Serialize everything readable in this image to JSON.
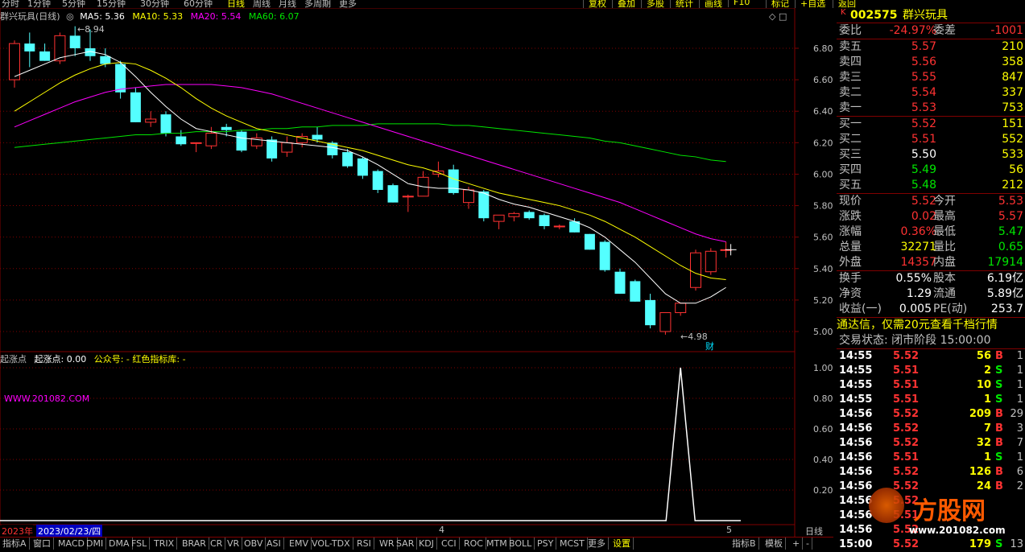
{
  "topbar": {
    "periods": [
      "分时",
      "1分钟",
      "5分钟",
      "15分钟",
      "30分钟",
      "60分钟",
      "日线",
      "周线",
      "月线",
      "多周期",
      "更多"
    ],
    "active_period": "日线",
    "right_buttons": [
      "复权",
      "叠加",
      "多股",
      "统计",
      "画线",
      "F10",
      "标记",
      "+自选",
      "返回"
    ]
  },
  "legend": {
    "title": "群兴玩具(日线)",
    "ma5": "MA5: 5.36",
    "ma10": "MA10: 5.33",
    "ma20": "MA20: 5.54",
    "ma60": "MA60: 6.07",
    "high_marker": "8.94",
    "low_marker": "4.98",
    "fin_marker": "财"
  },
  "colors": {
    "up": "#ff3232",
    "down": "#54ffff",
    "ma5": "#ffffff",
    "ma10": "#ffff00",
    "ma20": "#ff00ff",
    "ma60": "#00e600",
    "grid": "#800000"
  },
  "indicator": {
    "name": "起涨点",
    "value": "起涨点: 0.00",
    "public": "公众号: - 红色指标库: -",
    "watermark": "WWW.201082.COM",
    "y_ticks": [
      "1.00",
      "0.80",
      "0.60",
      "0.40",
      "0.20"
    ]
  },
  "chart_data": {
    "type": "candlestick",
    "y_ticks": [
      "6.80",
      "6.60",
      "6.40",
      "6.20",
      "6.00",
      "5.80",
      "5.60",
      "5.40",
      "5.20",
      "5.00"
    ],
    "ylim": [
      4.92,
      6.92
    ],
    "candles": [
      [
        6.6,
        6.85,
        6.55,
        6.83
      ],
      [
        6.83,
        6.9,
        6.68,
        6.78
      ],
      [
        6.78,
        6.83,
        6.72,
        6.72
      ],
      [
        6.72,
        6.9,
        6.7,
        6.88
      ],
      [
        6.88,
        6.94,
        6.75,
        6.8
      ],
      [
        6.8,
        6.92,
        6.72,
        6.75
      ],
      [
        6.75,
        6.8,
        6.68,
        6.7
      ],
      [
        6.7,
        6.72,
        6.48,
        6.52
      ],
      [
        6.52,
        6.55,
        6.33,
        6.33
      ],
      [
        6.33,
        6.4,
        6.3,
        6.35
      ],
      [
        6.38,
        6.4,
        6.24,
        6.26
      ],
      [
        6.24,
        6.28,
        6.18,
        6.19
      ],
      [
        6.2,
        6.2,
        6.14,
        6.2
      ],
      [
        6.18,
        6.3,
        6.16,
        6.26
      ],
      [
        6.3,
        6.32,
        6.24,
        6.28
      ],
      [
        6.27,
        6.28,
        6.14,
        6.15
      ],
      [
        6.18,
        6.26,
        6.16,
        6.23
      ],
      [
        6.22,
        6.24,
        6.08,
        6.1
      ],
      [
        6.14,
        6.24,
        6.11,
        6.2
      ],
      [
        6.2,
        6.26,
        6.17,
        6.24
      ],
      [
        6.25,
        6.3,
        6.2,
        6.22
      ],
      [
        6.2,
        6.21,
        6.1,
        6.12
      ],
      [
        6.14,
        6.16,
        6.04,
        6.05
      ],
      [
        6.1,
        6.11,
        5.97,
        5.99
      ],
      [
        6.02,
        6.03,
        5.88,
        5.9
      ],
      [
        5.93,
        5.94,
        5.82,
        5.82
      ],
      [
        5.86,
        5.87,
        5.76,
        5.86
      ],
      [
        5.86,
        6.02,
        5.86,
        5.98
      ],
      [
        6.0,
        6.08,
        5.98,
        6.02
      ],
      [
        6.03,
        6.06,
        5.87,
        5.88
      ],
      [
        5.82,
        5.92,
        5.78,
        5.9
      ],
      [
        5.89,
        5.9,
        5.7,
        5.72
      ],
      [
        5.7,
        5.74,
        5.65,
        5.74
      ],
      [
        5.73,
        5.76,
        5.7,
        5.75
      ],
      [
        5.76,
        5.77,
        5.71,
        5.72
      ],
      [
        5.74,
        5.75,
        5.65,
        5.67
      ],
      [
        5.67,
        5.68,
        5.65,
        5.67
      ],
      [
        5.7,
        5.72,
        5.63,
        5.63
      ],
      [
        5.62,
        5.62,
        5.52,
        5.52
      ],
      [
        5.57,
        5.58,
        5.38,
        5.39
      ],
      [
        5.38,
        5.4,
        5.24,
        5.24
      ],
      [
        5.32,
        5.33,
        5.19,
        5.19
      ],
      [
        5.2,
        5.24,
        5.02,
        5.04
      ],
      [
        5.0,
        5.12,
        4.98,
        5.12
      ],
      [
        5.12,
        5.18,
        5.1,
        5.18
      ],
      [
        5.28,
        5.52,
        5.26,
        5.5
      ],
      [
        5.38,
        5.53,
        5.36,
        5.51
      ],
      [
        5.52,
        5.57,
        5.47,
        5.52
      ]
    ],
    "ma5": [
      6.62,
      6.66,
      6.7,
      6.74,
      6.76,
      6.78,
      6.76,
      6.71,
      6.62,
      6.52,
      6.43,
      6.35,
      6.29,
      6.27,
      6.25,
      6.23,
      6.22,
      6.21,
      6.2,
      6.19,
      6.18,
      6.17,
      6.15,
      6.11,
      6.06,
      6.0,
      5.94,
      5.92,
      5.91,
      5.91,
      5.9,
      5.88,
      5.84,
      5.81,
      5.79,
      5.76,
      5.73,
      5.7,
      5.66,
      5.6,
      5.52,
      5.44,
      5.34,
      5.24,
      5.18,
      5.18,
      5.22,
      5.28,
      5.36
    ],
    "ma10": [
      6.4,
      6.46,
      6.52,
      6.58,
      6.63,
      6.67,
      6.7,
      6.71,
      6.7,
      6.66,
      6.61,
      6.55,
      6.48,
      6.42,
      6.37,
      6.33,
      6.29,
      6.27,
      6.25,
      6.23,
      6.21,
      6.19,
      6.17,
      6.15,
      6.12,
      6.09,
      6.06,
      6.04,
      6.01,
      5.97,
      5.94,
      5.91,
      5.88,
      5.86,
      5.84,
      5.82,
      5.8,
      5.77,
      5.74,
      5.7,
      5.65,
      5.6,
      5.54,
      5.48,
      5.42,
      5.37,
      5.34,
      5.33,
      5.33
    ],
    "ma20": [
      6.3,
      6.34,
      6.38,
      6.42,
      6.46,
      6.49,
      6.52,
      6.54,
      6.55,
      6.56,
      6.57,
      6.57,
      6.57,
      6.57,
      6.56,
      6.55,
      6.53,
      6.51,
      6.48,
      6.45,
      6.42,
      6.39,
      6.36,
      6.33,
      6.3,
      6.27,
      6.24,
      6.21,
      6.18,
      6.15,
      6.12,
      6.09,
      6.06,
      6.03,
      6.0,
      5.97,
      5.94,
      5.91,
      5.88,
      5.85,
      5.82,
      5.78,
      5.74,
      5.7,
      5.66,
      5.62,
      5.59,
      5.57,
      5.54
    ],
    "ma60": [
      6.17,
      6.18,
      6.19,
      6.2,
      6.21,
      6.22,
      6.23,
      6.24,
      6.25,
      6.25,
      6.26,
      6.26,
      6.27,
      6.27,
      6.27,
      6.28,
      6.28,
      6.29,
      6.29,
      6.3,
      6.3,
      6.31,
      6.31,
      6.31,
      6.32,
      6.32,
      6.32,
      6.32,
      6.32,
      6.31,
      6.31,
      6.3,
      6.29,
      6.28,
      6.27,
      6.26,
      6.25,
      6.24,
      6.23,
      6.21,
      6.2,
      6.18,
      6.16,
      6.14,
      6.12,
      6.11,
      6.09,
      6.08,
      6.07
    ],
    "indicator_signal_index": 44
  },
  "datebar": {
    "year": "2023年",
    "date": "2023/02/23/四",
    "month4": "4",
    "month5": "5",
    "right": "日线"
  },
  "bottombar": {
    "tabs": [
      "指标A",
      "窗口",
      "MACD",
      "DMI",
      "DMA",
      "FSL",
      "TRIX",
      "BRAR",
      "CR",
      "VR",
      "OBV",
      "ASI",
      "EMV",
      "VOL-TDX",
      "RSI",
      "WR",
      "SAR",
      "KDJ",
      "CCI",
      "ROC",
      "MTM",
      "BOLL",
      "PSY",
      "MCST",
      "更多",
      "设置"
    ],
    "right": [
      "指标B",
      "模板",
      "+",
      "-"
    ]
  },
  "quote": {
    "code": "002575",
    "name": "群兴玩具",
    "weibi_label": "委比",
    "weibi": "-24.97%",
    "weicha_label": "委差",
    "weicha": "-1001",
    "sells": [
      {
        "label": "卖五",
        "price": "5.57",
        "vol": "210"
      },
      {
        "label": "卖四",
        "price": "5.56",
        "vol": "358"
      },
      {
        "label": "卖三",
        "price": "5.55",
        "vol": "847"
      },
      {
        "label": "卖二",
        "price": "5.54",
        "vol": "337"
      },
      {
        "label": "卖一",
        "price": "5.53",
        "vol": "753"
      }
    ],
    "buys": [
      {
        "label": "买一",
        "price": "5.52",
        "vol": "151",
        "pc": "red"
      },
      {
        "label": "买二",
        "price": "5.51",
        "vol": "552",
        "pc": "red"
      },
      {
        "label": "买三",
        "price": "5.50",
        "vol": "533",
        "pc": "white"
      },
      {
        "label": "买四",
        "price": "5.49",
        "vol": "56",
        "pc": "green"
      },
      {
        "label": "买五",
        "price": "5.48",
        "vol": "212",
        "pc": "green"
      }
    ],
    "stats": [
      {
        "l1": "现价",
        "v1": "5.52",
        "c1": "red",
        "l2": "今开",
        "v2": "5.53",
        "c2": "red"
      },
      {
        "l1": "涨跌",
        "v1": "0.02",
        "c1": "red",
        "l2": "最高",
        "v2": "5.57",
        "c2": "red"
      },
      {
        "l1": "涨幅",
        "v1": "0.36%",
        "c1": "red",
        "l2": "最低",
        "v2": "5.47",
        "c2": "green"
      },
      {
        "l1": "总量",
        "v1": "32271",
        "c1": "yellow",
        "l2": "量比",
        "v2": "0.65",
        "c2": "green"
      },
      {
        "l1": "外盘",
        "v1": "14357",
        "c1": "red",
        "l2": "内盘",
        "v2": "17914",
        "c2": "green"
      }
    ],
    "stats2": [
      {
        "l1": "换手",
        "v1": "0.55%",
        "l2": "股本",
        "v2": "6.19亿"
      },
      {
        "l1": "净资",
        "v1": "1.29",
        "l2": "流通",
        "v2": "5.89亿"
      },
      {
        "l1": "收益(一)",
        "v1": "0.005",
        "l2": "PE(动)",
        "v2": "253.7"
      }
    ],
    "ad": "通达信，仅需20元查看千档行情",
    "trade_state": "交易状态: 闭市阶段 15:00:00",
    "ticks": [
      {
        "t": "14:55",
        "p": "5.52",
        "v": "56",
        "s": "B",
        "n": "1"
      },
      {
        "t": "14:55",
        "p": "5.51",
        "v": "2",
        "s": "S",
        "n": "1"
      },
      {
        "t": "14:55",
        "p": "5.51",
        "v": "10",
        "s": "S",
        "n": "1"
      },
      {
        "t": "14:55",
        "p": "5.51",
        "v": "1",
        "s": "S",
        "n": "1"
      },
      {
        "t": "14:56",
        "p": "5.52",
        "v": "209",
        "s": "B",
        "n": "29"
      },
      {
        "t": "14:56",
        "p": "5.52",
        "v": "7",
        "s": "B",
        "n": "3"
      },
      {
        "t": "14:56",
        "p": "5.52",
        "v": "32",
        "s": "B",
        "n": "7"
      },
      {
        "t": "14:56",
        "p": "5.51",
        "v": "1",
        "s": "S",
        "n": "1"
      },
      {
        "t": "14:56",
        "p": "5.52",
        "v": "126",
        "s": "B",
        "n": "6"
      },
      {
        "t": "14:56",
        "p": "5.52",
        "v": "24",
        "s": "B",
        "n": "2"
      },
      {
        "t": "14:56",
        "p": "5.52",
        "v": "",
        "s": "",
        "n": ""
      },
      {
        "t": "14:56",
        "p": "5.51",
        "v": "",
        "s": "",
        "n": ""
      },
      {
        "t": "14:56",
        "p": "5.52",
        "v": "",
        "s": "",
        "n": ""
      },
      {
        "t": "15:00",
        "p": "5.52",
        "v": "179",
        "s": "S",
        "n": "13"
      }
    ],
    "watermark": "方股网",
    "watermark_url": "www.201082.com"
  }
}
